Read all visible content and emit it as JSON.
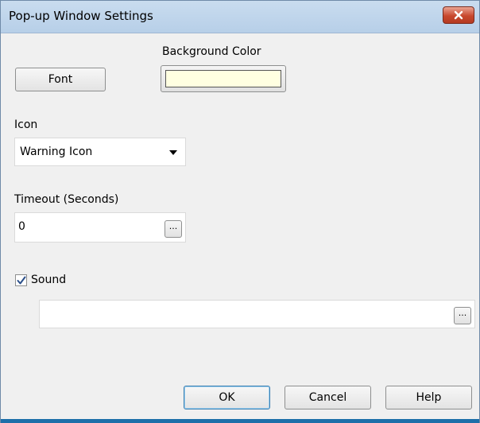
{
  "window": {
    "title": "Pop-up Window Settings",
    "close_icon": "close-icon"
  },
  "font_section": {
    "font_button_label": "Font"
  },
  "background_section": {
    "label": "Background Color",
    "color": "#ffffe1"
  },
  "icon_section": {
    "label": "Icon",
    "selected": "Warning Icon",
    "arrow_icon": "dropdown-arrow-icon"
  },
  "timeout_section": {
    "label": "Timeout (Seconds)",
    "value": "0",
    "browse_label": "..."
  },
  "sound_section": {
    "label": "Sound",
    "checked": true,
    "path_value": "",
    "browse_label": "..."
  },
  "footer": {
    "ok_label": "OK",
    "cancel_label": "Cancel",
    "help_label": "Help"
  },
  "colors": {
    "titlebar": "#c9dcef",
    "close_button": "#c8492f",
    "dialog_background": "#f0f0f0",
    "bottom_strip": "#1d6fa9"
  }
}
